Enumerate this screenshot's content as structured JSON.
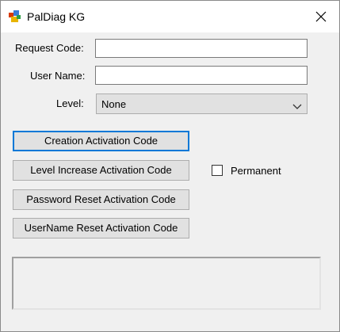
{
  "window": {
    "title": "PalDiag KG",
    "icon": "app-icon"
  },
  "form": {
    "request_code": {
      "label": "Request Code:",
      "value": ""
    },
    "user_name": {
      "label": "User Name:",
      "value": ""
    },
    "level": {
      "label": "Level:",
      "selected": "None"
    }
  },
  "buttons": {
    "creation": "Creation Activation Code",
    "level_increase": "Level Increase Activation Code",
    "password_reset": "Password Reset Activation Code",
    "username_reset": "UserName Reset Activation Code"
  },
  "permanent": {
    "label": "Permanent",
    "checked": false
  },
  "colors": {
    "focus_border": "#0078d7",
    "button_face": "#e1e1e1",
    "window_bg": "#f0f0f0"
  }
}
